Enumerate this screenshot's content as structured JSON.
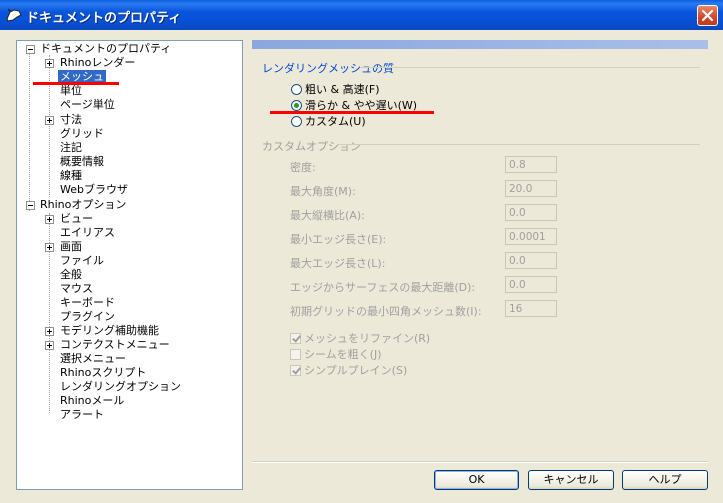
{
  "window": {
    "title": "ドキュメントのプロパティ"
  },
  "tree": {
    "items": [
      {
        "label": "ドキュメントのプロパティ",
        "expander": "minus"
      },
      {
        "label": "Rhinoレンダー",
        "expander": "plus"
      },
      {
        "label": "メッシュ",
        "selected": true
      },
      {
        "label": "単位"
      },
      {
        "label": "ページ単位"
      },
      {
        "label": "寸法",
        "expander": "plus"
      },
      {
        "label": "グリッド"
      },
      {
        "label": "注記"
      },
      {
        "label": "概要情報"
      },
      {
        "label": "線種"
      },
      {
        "label": "Webブラウザ"
      },
      {
        "label": "Rhinoオプション",
        "expander": "minus"
      },
      {
        "label": "ビュー",
        "expander": "plus"
      },
      {
        "label": "エイリアス"
      },
      {
        "label": "画面",
        "expander": "plus"
      },
      {
        "label": "ファイル"
      },
      {
        "label": "全般"
      },
      {
        "label": "マウス"
      },
      {
        "label": "キーボード"
      },
      {
        "label": "プラグイン"
      },
      {
        "label": "モデリング補助機能",
        "expander": "plus"
      },
      {
        "label": "コンテクストメニュー",
        "expander": "plus"
      },
      {
        "label": "選択メニュー"
      },
      {
        "label": "Rhinoスクリプト"
      },
      {
        "label": "レンダリングオプション"
      },
      {
        "label": "Rhinoメール"
      },
      {
        "label": "アラート"
      }
    ]
  },
  "mesh_quality": {
    "title": "レンダリングメッシュの質",
    "options": [
      {
        "label": "粗い & 高速(F)",
        "checked": false
      },
      {
        "label": "滑らか & やや遅い(W)",
        "checked": true
      },
      {
        "label": "カスタム(U)",
        "checked": false
      }
    ]
  },
  "custom_options": {
    "title": "カスタムオプション",
    "fields": [
      {
        "label": "密度:",
        "value": "0.8"
      },
      {
        "label": "最大角度(M):",
        "value": "20.0"
      },
      {
        "label": "最大縦横比(A):",
        "value": "0.0"
      },
      {
        "label": "最小エッジ長さ(E):",
        "value": "0.0001"
      },
      {
        "label": "最大エッジ長さ(L):",
        "value": "0.0"
      },
      {
        "label": "エッジからサーフェスの最大距離(D):",
        "value": "0.0"
      },
      {
        "label": "初期グリッドの最小四角メッシュ数(I):",
        "value": "16"
      }
    ],
    "checkboxes": [
      {
        "label": "メッシュをリファイン(R)",
        "checked": true
      },
      {
        "label": "シームを粗く(J)",
        "checked": false
      },
      {
        "label": "シンプルプレイン(S)",
        "checked": true
      }
    ]
  },
  "buttons": {
    "ok": "OK",
    "cancel": "キャンセル",
    "help": "ヘルプ"
  },
  "colors": {
    "titlebar": "#0855dd",
    "selection": "#316ac5",
    "group_title": "#0046d5",
    "annotation": "#ff0000"
  }
}
